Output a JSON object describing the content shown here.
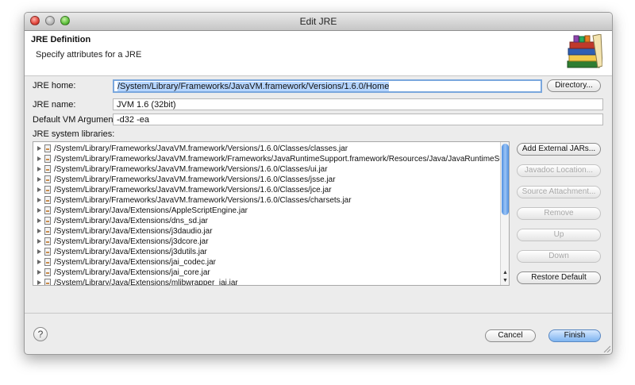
{
  "window": {
    "title": "Edit JRE"
  },
  "header": {
    "title": "JRE Definition",
    "subtitle": "Specify attributes for a JRE",
    "icon": "books-icon"
  },
  "form": {
    "jre_home_label": "JRE home:",
    "jre_home_value": "/System/Library/Frameworks/JavaVM.framework/Versions/1.6.0/Home",
    "directory_button": "Directory...",
    "jre_name_label": "JRE name:",
    "jre_name_value": "JVM 1.6 (32bit)",
    "vm_args_label": "Default VM Arguments:",
    "vm_args_value": "-d32 -ea",
    "libraries_label": "JRE system libraries:"
  },
  "libraries": [
    "/System/Library/Frameworks/JavaVM.framework/Versions/1.6.0/Classes/classes.jar",
    "/System/Library/Frameworks/JavaVM.framework/Frameworks/JavaRuntimeSupport.framework/Resources/Java/JavaRuntimeSupport.jar",
    "/System/Library/Frameworks/JavaVM.framework/Versions/1.6.0/Classes/ui.jar",
    "/System/Library/Frameworks/JavaVM.framework/Versions/1.6.0/Classes/jsse.jar",
    "/System/Library/Frameworks/JavaVM.framework/Versions/1.6.0/Classes/jce.jar",
    "/System/Library/Frameworks/JavaVM.framework/Versions/1.6.0/Classes/charsets.jar",
    "/System/Library/Java/Extensions/AppleScriptEngine.jar",
    "/System/Library/Java/Extensions/dns_sd.jar",
    "/System/Library/Java/Extensions/j3daudio.jar",
    "/System/Library/Java/Extensions/j3dcore.jar",
    "/System/Library/Java/Extensions/j3dutils.jar",
    "/System/Library/Java/Extensions/jai_codec.jar",
    "/System/Library/Java/Extensions/jai_core.jar",
    "/System/Library/Java/Extensions/mlibwrapper_jai.jar"
  ],
  "side_buttons": {
    "add_external": "Add External JARs...",
    "javadoc": "Javadoc Location...",
    "source": "Source Attachment...",
    "remove": "Remove",
    "up": "Up",
    "down": "Down",
    "restore": "Restore Default"
  },
  "footer": {
    "help": "?",
    "cancel": "Cancel",
    "finish": "Finish"
  },
  "colors": {
    "accent": "#7eb4f0",
    "selection": "#b5d5ff"
  }
}
